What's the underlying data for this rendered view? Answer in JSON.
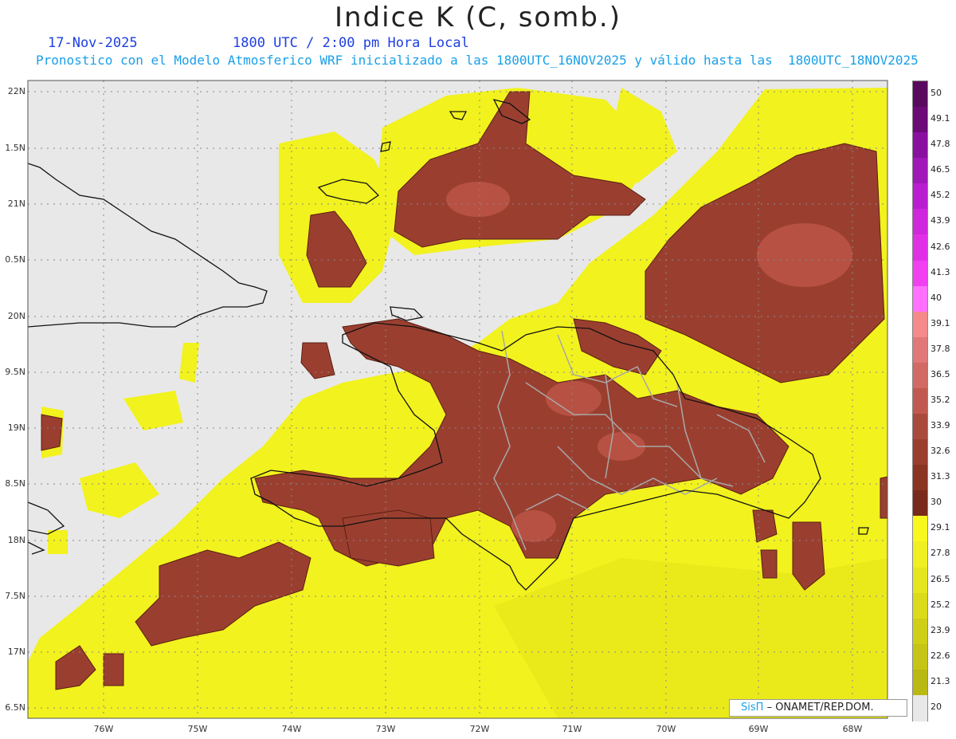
{
  "title": "Indice K (C, somb.)",
  "date": "17-Nov-2025",
  "time": "1800 UTC / 2:00 pm Hora Local",
  "subtitle": "Pronostico con el Modelo Atmosferico WRF inicializado a las 1800UTC_16NOV2025 y válido hasta las  1800UTC_18NOV2025",
  "credit": {
    "brand": "SisΠ",
    "text": "– ONAMET/REP.DOM."
  },
  "lat_labels": [
    "22N",
    "1.5N",
    "21N",
    "0.5N",
    "20N",
    "9.5N",
    "19N",
    "8.5N",
    "18N",
    "7.5N",
    "17N",
    "6.5N"
  ],
  "lon_labels": [
    "76W",
    "75W",
    "74W",
    "73W",
    "72W",
    "71W",
    "70W",
    "69W",
    "68W"
  ],
  "colorbar": {
    "labels": [
      "50",
      "49.1",
      "47.8",
      "46.5",
      "45.2",
      "43.9",
      "42.6",
      "41.3",
      "40",
      "39.1",
      "37.8",
      "36.5",
      "35.2",
      "33.9",
      "32.6",
      "31.3",
      "30",
      "29.1",
      "27.8",
      "26.5",
      "25.2",
      "23.9",
      "22.6",
      "21.3",
      "20"
    ],
    "colors": [
      "#5a0a5e",
      "#6c0a78",
      "#8a10a0",
      "#a018b8",
      "#b81ed0",
      "#cf28dc",
      "#e030e6",
      "#f040f0",
      "#ff70ff",
      "#f48a8a",
      "#e07878",
      "#d06a62",
      "#c05a50",
      "#a84a3c",
      "#9a3e2e",
      "#8a3422",
      "#7a2a1a",
      "#f8f820",
      "#f0ef22",
      "#e6e61e",
      "#dbdb1a",
      "#d0cf18",
      "#c6c414",
      "#bab812",
      "#e8e8e8"
    ]
  },
  "colors": {
    "background": "#e8e8e8",
    "low": "#f2f21e",
    "high": "#9a3f30",
    "coast": "#111111",
    "borders": "#999999"
  }
}
